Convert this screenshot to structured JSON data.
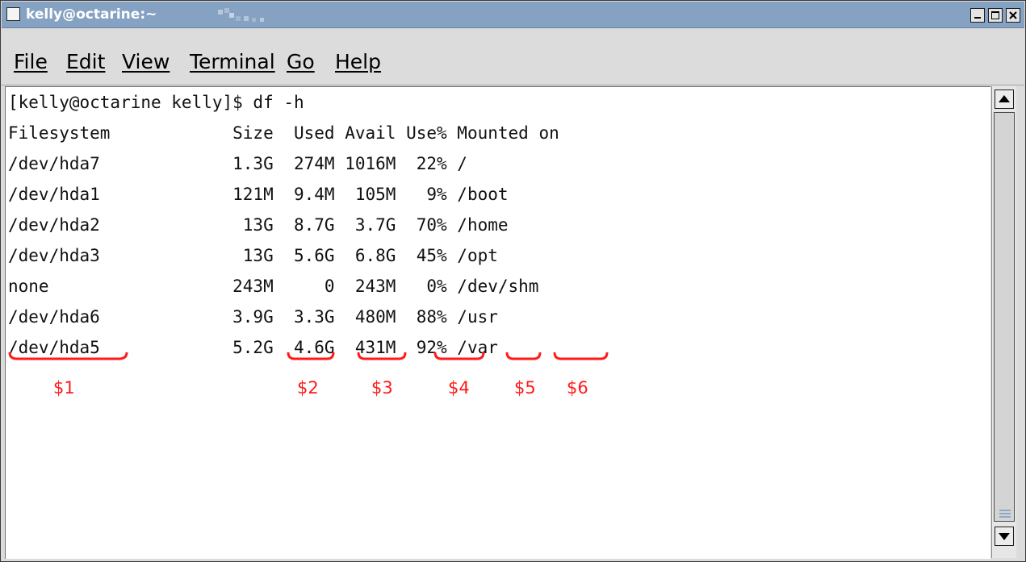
{
  "window": {
    "title": "kelly@octarine:~",
    "controls": [
      "minimize-icon",
      "maximize-icon",
      "close-icon"
    ]
  },
  "menu": [
    {
      "label": "File"
    },
    {
      "label": "Edit"
    },
    {
      "label": "View"
    },
    {
      "label": "Terminal"
    },
    {
      "label": "Go"
    },
    {
      "label": "Help"
    }
  ],
  "terminal": {
    "lines": [
      "[kelly@octarine kelly]$ df -h",
      "Filesystem            Size  Used Avail Use% Mounted on",
      "/dev/hda7             1.3G  274M 1016M  22% /",
      "/dev/hda1             121M  9.4M  105M   9% /boot",
      "/dev/hda2              13G  8.7G  3.7G  70% /home",
      "/dev/hda3              13G  5.6G  6.8G  45% /opt",
      "none                  243M     0  243M   0% /dev/shm",
      "/dev/hda6             3.9G  3.3G  480M  88% /usr",
      "/dev/hda5             5.2G  4.6G  431M  92% /var"
    ]
  },
  "annotations": [
    "$1",
    "$2",
    "$3",
    "$4",
    "$5",
    "$6"
  ],
  "colors": {
    "titlebar": "#86a2c3",
    "annotation": "#ff1a1a",
    "terminal_bg": "#ffffff"
  }
}
